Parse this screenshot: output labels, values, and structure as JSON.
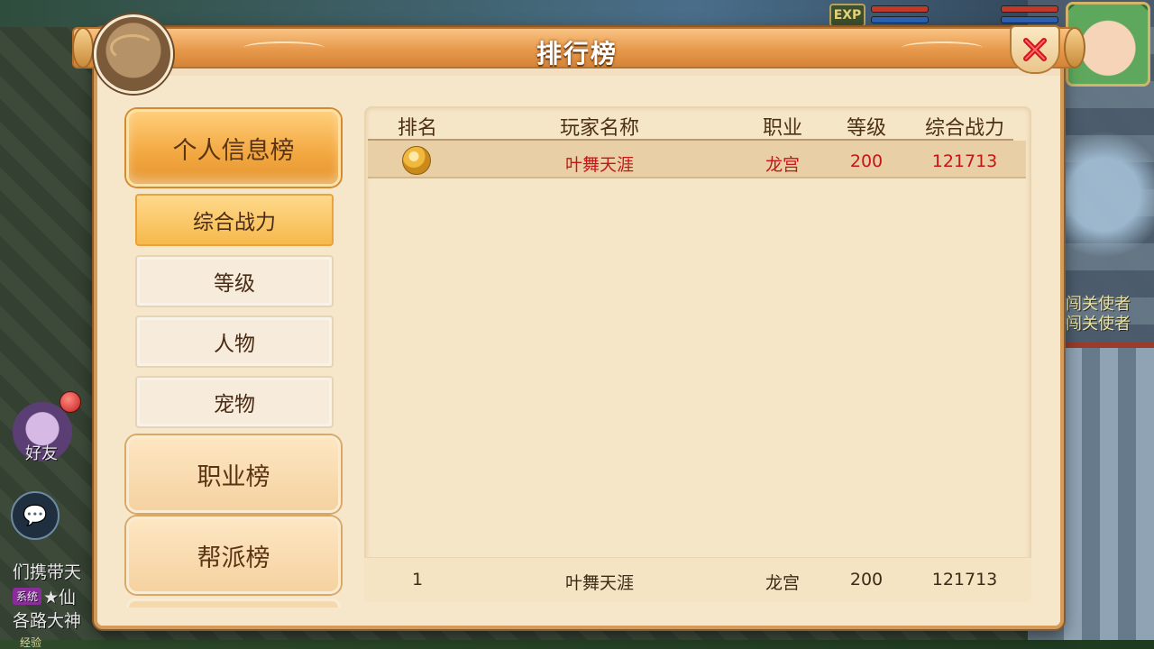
{
  "modal": {
    "title": "排行榜"
  },
  "hud": {
    "exp_badge": "EXP",
    "npc_labels": [
      "闯关使者",
      "闯关使者"
    ],
    "friend_label": "好友",
    "chat_lines": [
      "们携带天",
      "★仙",
      "各路大神"
    ],
    "system_tag": "系统",
    "exp_label": "经验"
  },
  "menu": {
    "categories": [
      {
        "label": "个人信息榜",
        "active": true
      },
      {
        "label": "职业榜",
        "active": false
      },
      {
        "label": "帮派榜",
        "active": false
      }
    ],
    "sub_items": [
      {
        "label": "综合战力",
        "active": true
      },
      {
        "label": "等级",
        "active": false
      },
      {
        "label": "人物",
        "active": false
      },
      {
        "label": "宠物",
        "active": false
      }
    ]
  },
  "ranking": {
    "columns": [
      "排名",
      "玩家名称",
      "职业",
      "等级",
      "综合战力"
    ],
    "rows": [
      {
        "rank_icon": "gold-medal-icon",
        "name": "叶舞天涯",
        "job": "龙宫",
        "level": "200",
        "power": "121713"
      }
    ],
    "my_rank": {
      "rank": "1",
      "name": "叶舞天涯",
      "job": "龙宫",
      "level": "200",
      "power": "121713"
    }
  },
  "colors": {
    "highlight_text": "#c51616",
    "active_tab": "#f2a73f",
    "frame": "#d49a58"
  }
}
